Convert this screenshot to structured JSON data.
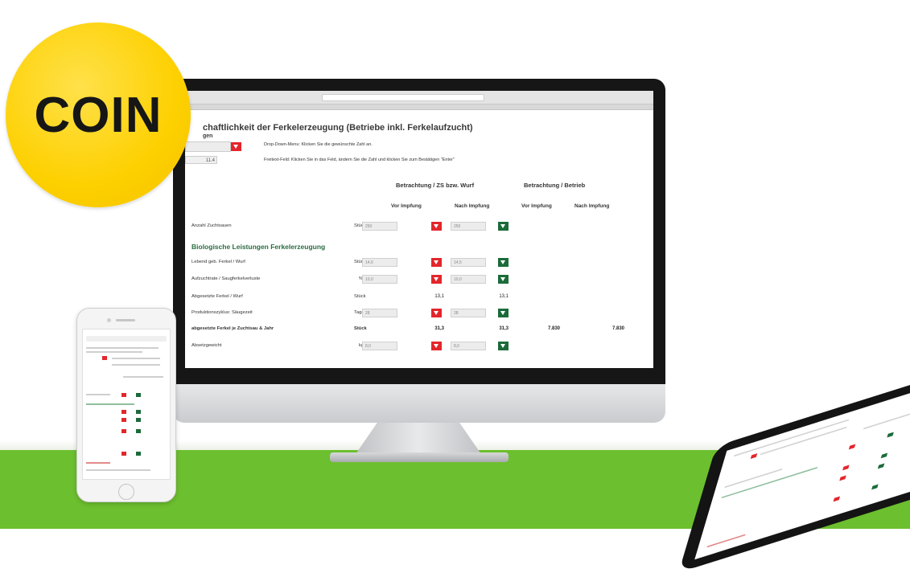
{
  "badge": {
    "text": "COIN"
  },
  "colors": {
    "green_band": "#6cbf2e",
    "badge": "#fdd000",
    "dropdown_red": "#e3262b",
    "confirm_green": "#1b6b3a",
    "section_green": "#2a6c42"
  },
  "app": {
    "title": "chaftlichkeit der Ferkelerzeugung (Betriebe inkl. Ferkelaufzucht)",
    "subtitle": "gen",
    "dropdown_hint": "Drop-Down-Menu: Klicken Sie die gewünschte Zahl an.",
    "free_field_value": "11.4",
    "free_field_hint": "Freitext-Feld: Klicken Sie in das Feld, ändern Sie die Zahl und klicken Sie zum Bestätigen \"Enter\"",
    "group_headers": {
      "per_sow": "Betrachtung / ZS bzw. Wurf",
      "per_farm": "Betrachtung / Betrieb"
    },
    "col_headers": [
      "Vor Impfung",
      "Nach Impfung",
      "Vor Impfung",
      "Nach Impfung"
    ],
    "row_sows": {
      "label": "Anzahl Zuchtsauen",
      "unit": "Stück",
      "vor": "250",
      "nach": "250"
    },
    "section_bio": "Biologische Leistungen Ferkelerzeugung",
    "rows": [
      {
        "label": "Lebend geb. Ferkel / Wurf",
        "unit": "Stück",
        "vor": "14,6",
        "nach": "14,5"
      },
      {
        "label": "Aufzuchtrate / Saugferkelverluste",
        "unit": "%",
        "vor": "10,0",
        "nach": "10,0"
      },
      {
        "label": "Abgesetzte Ferkel / Wurf",
        "unit": "Stück",
        "vor": "13,1",
        "nach": "13,1"
      },
      {
        "label": "Produktionszyklus: Säugezeit",
        "unit": "Tage",
        "vor": "28",
        "nach": "28"
      },
      {
        "label": "abgesetzte Ferkel je Zuchtsau & Jahr",
        "unit": "Stück",
        "vor": "31,3",
        "nach": "31,3",
        "farm_vor": "7.830",
        "farm_nach": "7.830"
      },
      {
        "label": "Absetzgewicht",
        "unit": "kg",
        "vor": "8,0",
        "nach": "8,0"
      }
    ]
  },
  "icons": [
    "dropdown-arrow-icon",
    "confirm-arrow-icon"
  ]
}
